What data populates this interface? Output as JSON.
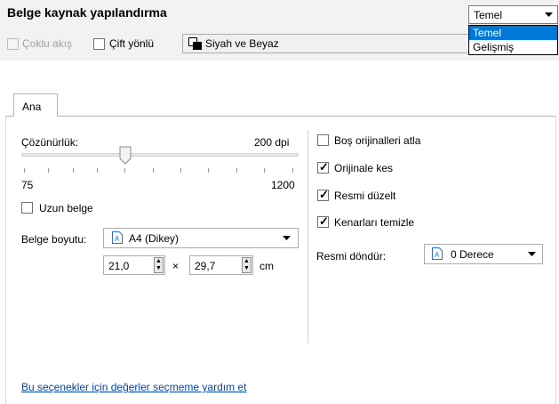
{
  "header": {
    "title": "Belge kaynak yapılandırma",
    "multiflow_label": "Çoklu akış",
    "duplex_label": "Çift yönlü",
    "color_mode": "Siyah ve Beyaz",
    "profile_selected": "Temel",
    "profile_options": [
      "Temel",
      "Gelişmiş"
    ]
  },
  "tabs": {
    "main": "Ana"
  },
  "left": {
    "resolution_label": "Çözünürlük:",
    "resolution_value": "200 dpi",
    "slider_min": "75",
    "slider_max": "1200",
    "long_doc_label": "Uzun belge",
    "size_label": "Belge boyutu:",
    "size_value": "A4 (Dikey)",
    "width_value": "21,0",
    "times": "×",
    "height_value": "29,7",
    "unit": "cm"
  },
  "right": {
    "skip_blank": "Boş orijinalleri atla",
    "crop": "Orijinale kes",
    "deskew": "Resmi düzelt",
    "clean_edges": "Kenarları temizle",
    "rotate_label": "Resmi döndür:",
    "rotate_value": "0 Derece"
  },
  "footer": {
    "help_link": "Bu seçenekler için değerler seçmeme yardım et"
  },
  "colors": {
    "selection": "#0078d7",
    "link": "#0645ad"
  }
}
